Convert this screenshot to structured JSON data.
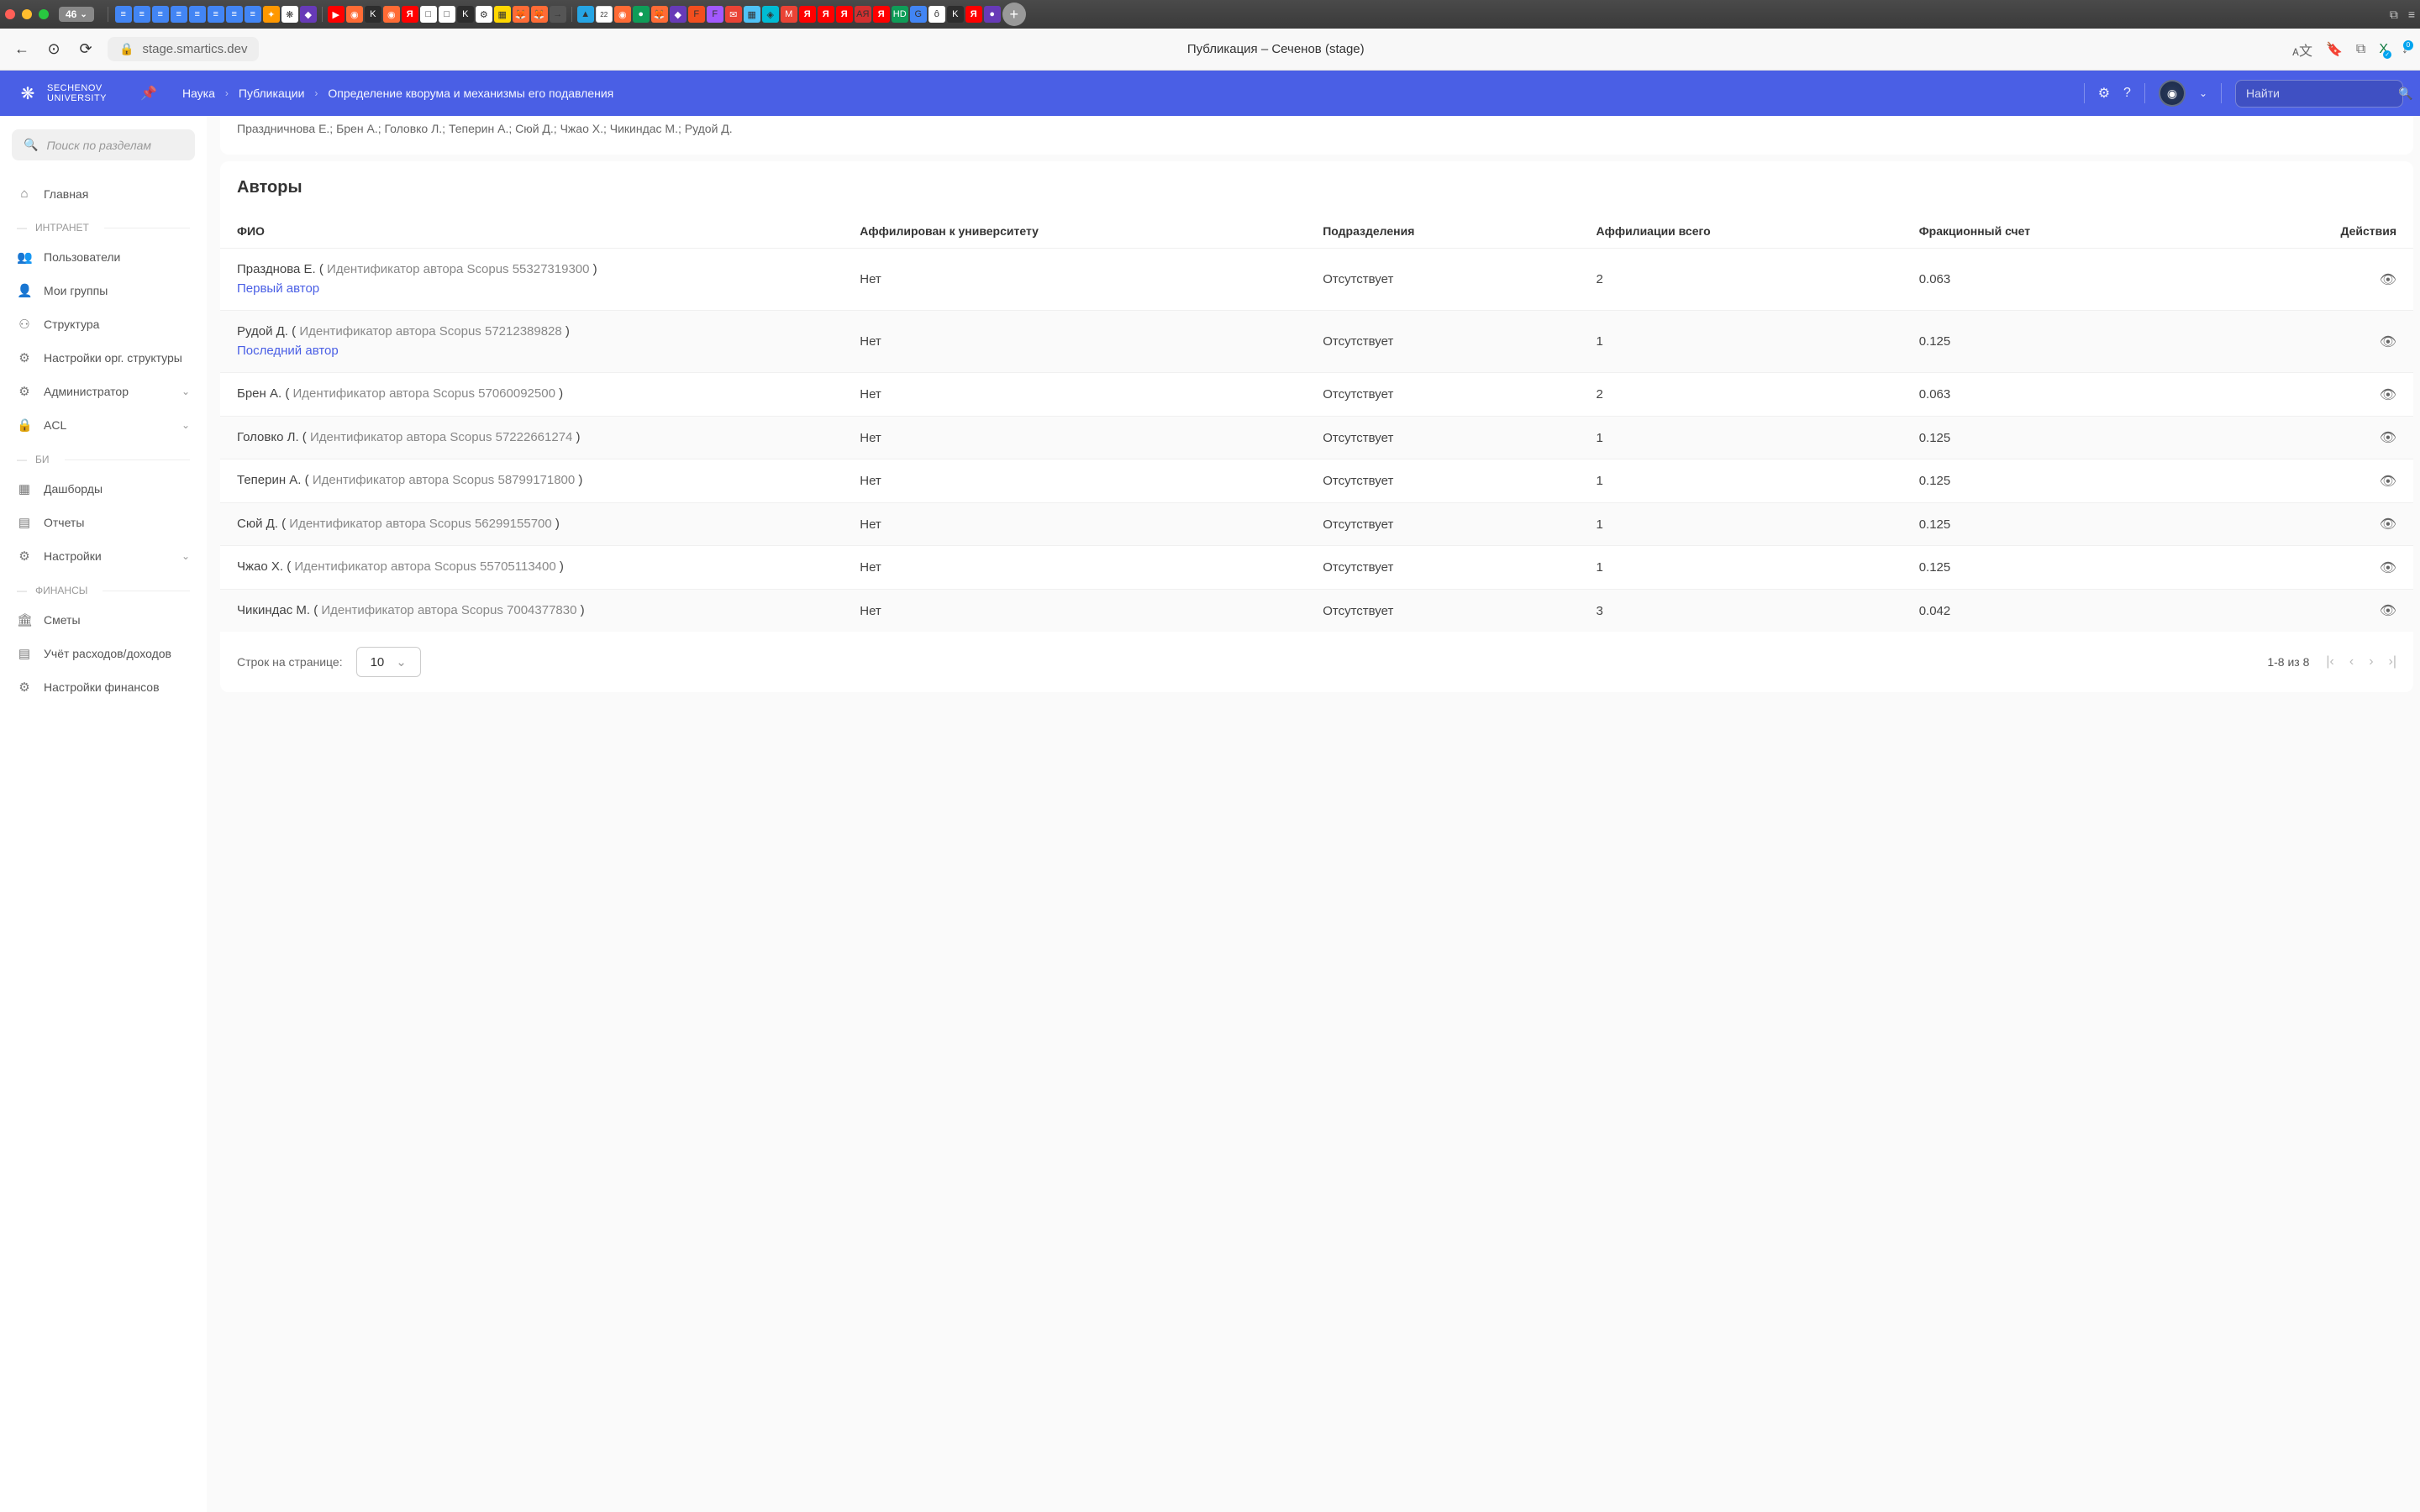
{
  "macbar": {
    "tab_count": "46"
  },
  "browser": {
    "url": "stage.smartics.dev",
    "title": "Публикация – Сеченов (stage)"
  },
  "header": {
    "logo_line1": "SECHENOV",
    "logo_line2": "UNIVERSITY",
    "search_placeholder": "Найти"
  },
  "breadcrumbs": [
    "Наука",
    "Публикации",
    "Определение кворума и механизмы его подавления"
  ],
  "sidebar": {
    "search_placeholder": "Поиск по разделам",
    "home": "Главная",
    "sections": {
      "intranet": {
        "label": "ИНТРАНЕТ",
        "items": [
          "Пользователи",
          "Мои группы",
          "Структура",
          "Настройки орг. структуры",
          "Администратор",
          "ACL"
        ]
      },
      "bi": {
        "label": "БИ",
        "items": [
          "Дашборды",
          "Отчеты",
          "Настройки"
        ]
      },
      "finance": {
        "label": "ФИНАНСЫ",
        "items": [
          "Сметы",
          "Учёт расходов/доходов",
          "Настройки финансов"
        ]
      }
    }
  },
  "author_line": "Праздничнова Е.; Брен А.; Головко Л.; Теперин А.; Сюй Д.; Чжао Х.; Чикиндас М.; Рудой Д.",
  "authors_card": {
    "title": "Авторы"
  },
  "columns": {
    "fio": "ФИО",
    "affiliated": "Аффилирован к университету",
    "subdivisions": "Подразделения",
    "affiliations_total": "Аффилиации всего",
    "fractional": "Фракционный счет",
    "actions": "Действия"
  },
  "rows": [
    {
      "name": "Празднова Е.",
      "scopus": "Идентификатор автора Scopus 55327319300",
      "tag": "Первый автор",
      "affiliated": "Нет",
      "sub": "Отсутствует",
      "aff": "2",
      "frac": "0.063"
    },
    {
      "name": "Рудой Д.",
      "scopus": "Идентификатор автора Scopus 57212389828",
      "tag": "Последний автор",
      "affiliated": "Нет",
      "sub": "Отсутствует",
      "aff": "1",
      "frac": "0.125"
    },
    {
      "name": "Брен А.",
      "scopus": "Идентификатор автора Scopus 57060092500",
      "tag": "",
      "affiliated": "Нет",
      "sub": "Отсутствует",
      "aff": "2",
      "frac": "0.063"
    },
    {
      "name": "Головко Л.",
      "scopus": "Идентификатор автора Scopus 57222661274",
      "tag": "",
      "affiliated": "Нет",
      "sub": "Отсутствует",
      "aff": "1",
      "frac": "0.125"
    },
    {
      "name": "Теперин А.",
      "scopus": "Идентификатор автора Scopus 58799171800",
      "tag": "",
      "affiliated": "Нет",
      "sub": "Отсутствует",
      "aff": "1",
      "frac": "0.125"
    },
    {
      "name": "Сюй Д.",
      "scopus": "Идентификатор автора Scopus 56299155700",
      "tag": "",
      "affiliated": "Нет",
      "sub": "Отсутствует",
      "aff": "1",
      "frac": "0.125"
    },
    {
      "name": "Чжао Х.",
      "scopus": "Идентификатор автора Scopus 55705113400",
      "tag": "",
      "affiliated": "Нет",
      "sub": "Отсутствует",
      "aff": "1",
      "frac": "0.125"
    },
    {
      "name": "Чикиндас М.",
      "scopus": "Идентификатор автора Scopus 7004377830",
      "tag": "",
      "affiliated": "Нет",
      "sub": "Отсутствует",
      "aff": "3",
      "frac": "0.042"
    }
  ],
  "pagination": {
    "rows_label": "Строк на странице:",
    "page_size": "10",
    "info": "1-8 из 8"
  }
}
